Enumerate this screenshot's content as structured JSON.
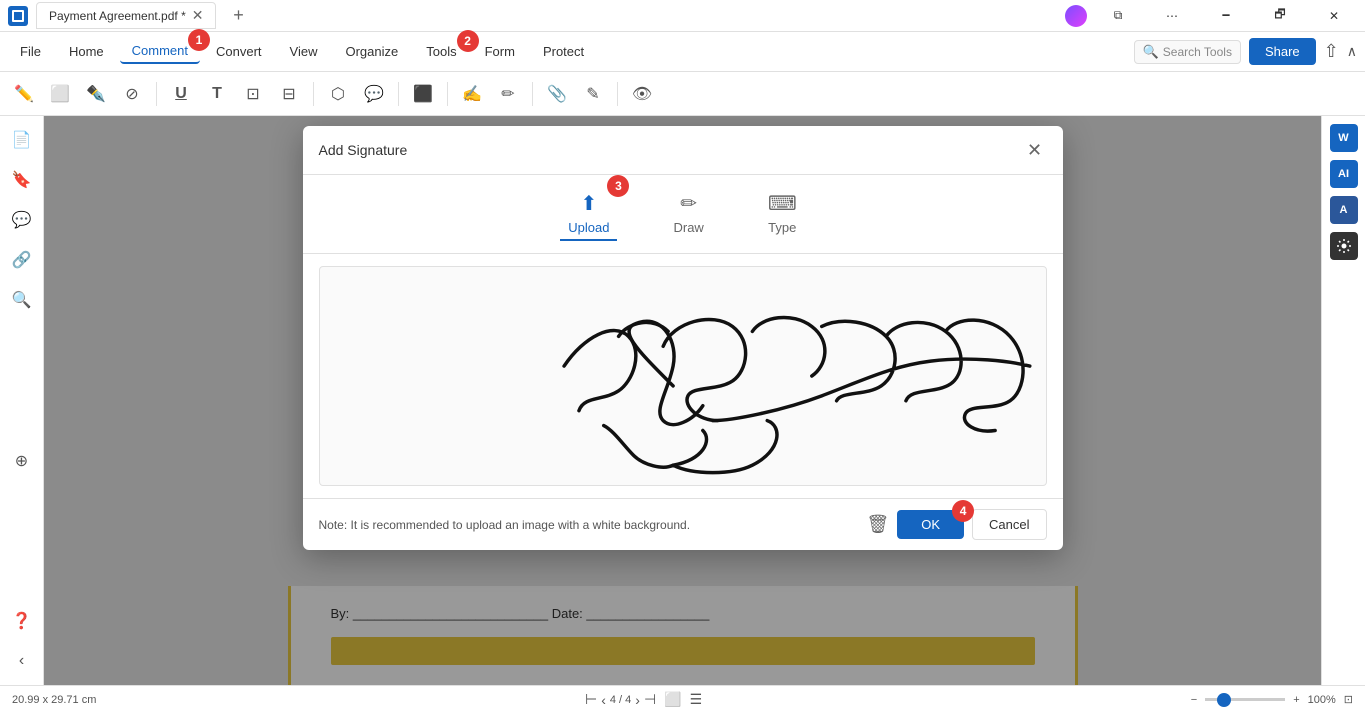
{
  "titlebar": {
    "tab_title": "Payment Agreement.pdf *",
    "new_tab_label": "+",
    "minimize": "🗕",
    "maximize": "🗗",
    "close": "✕"
  },
  "menubar": {
    "items": [
      "File",
      "Home",
      "Comment",
      "Convert",
      "View",
      "Organize",
      "Tools",
      "Form",
      "Protect"
    ],
    "active": "Comment",
    "search_placeholder": "Search Tools",
    "share_label": "Share"
  },
  "toolbar": {
    "tools": [
      "✏",
      "⬜",
      "✒",
      "⊘",
      "U",
      "T",
      "⊡",
      "⊟",
      "⬡",
      "💬",
      "⬛",
      "✋",
      "✒",
      "📎",
      "✎",
      "👁"
    ]
  },
  "left_sidebar": {
    "icons": [
      "📄",
      "🔖",
      "💬",
      "🔗",
      "🔍",
      "⊕"
    ]
  },
  "right_sidebar": {
    "icons": [
      "W",
      "A",
      "A"
    ]
  },
  "dialog": {
    "title": "Add Signature",
    "tabs": [
      {
        "label": "Upload",
        "active": true
      },
      {
        "label": "Draw",
        "active": false
      },
      {
        "label": "Type",
        "active": false
      }
    ],
    "note": "Note: It is recommended to upload an image with a white background.",
    "ok_label": "OK",
    "cancel_label": "Cancel"
  },
  "status_bar": {
    "dimensions": "20.99 x 29.71 cm",
    "page_current": "4",
    "page_total": "4",
    "zoom": "100%"
  },
  "pdf_bottom": {
    "by_label": "By: ___________________________ Date: _________________"
  },
  "steps": {
    "s1": "1",
    "s2": "2",
    "s3": "3",
    "s4": "4"
  }
}
